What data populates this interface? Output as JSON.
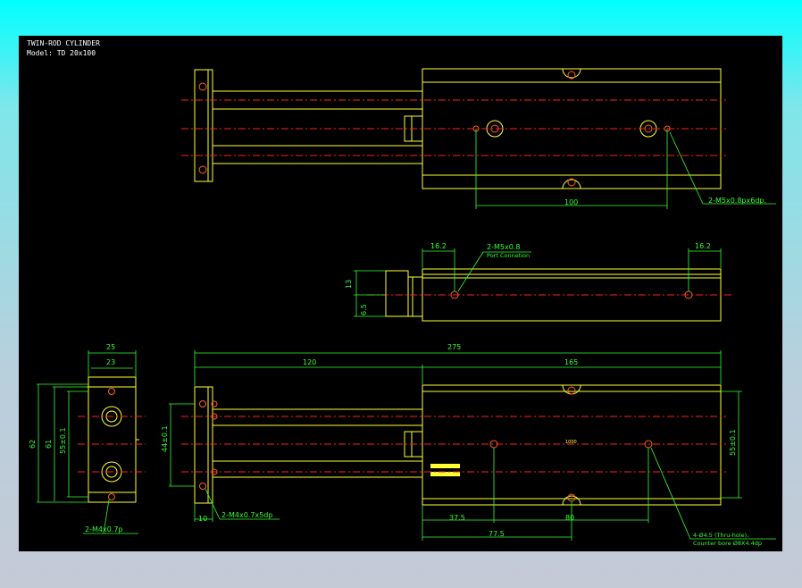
{
  "title": {
    "line1": "TWIN-ROD CYLINDER",
    "line2": "Model: TD 20x100"
  },
  "dims": {
    "d100": "100",
    "m5_depth": "2-M5x0.8px6dp.",
    "d16_2_left": "16.2",
    "m5_port": "2-M5x0.8",
    "port_conn": "Port Connetion",
    "d16_2_right": "16.2",
    "d13": "13",
    "d6_5": "6.5",
    "d25": "25",
    "d23": "23",
    "d62": "62",
    "d61": "61",
    "d55_left": "55±0.1",
    "d44": "44±0.1",
    "d275": "275",
    "d120": "120",
    "d165": "165",
    "d55_right": "55±0.1",
    "d10": "10",
    "m4_tap": "2-M4x0.7x5dp",
    "m4_left": "2-M4x0.7p",
    "d37_5": "37.5",
    "d80": "80",
    "d77_5": "77.5",
    "thru_hole": "4-Ø4.5 (Thru-hole),",
    "counter_bore": "Counter bore Ø8X4.4dp",
    "center_mark": "1000"
  }
}
